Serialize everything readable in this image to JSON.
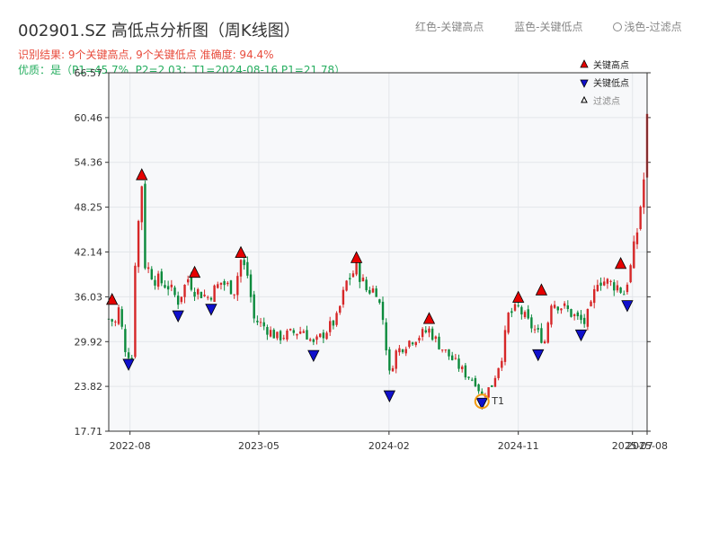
{
  "title": "002901.SZ 高低点分析图（周K线图）",
  "subtitle_result": "识别结果: 9个关键高点, 9个关键低点  准确度: 94.4%",
  "subtitle_quality": "优质：是（P1=45.7%, P2=2.03；T1=2024-08-16 P1=21.78）",
  "top_legend": {
    "red": "红色-关键高点",
    "blue": "蓝色-关键低点",
    "light": "浅色-过滤点"
  },
  "colors": {
    "up": "#d62728",
    "down": "#0b8a3c",
    "high_marker": "#e60000",
    "low_marker": "#1010cc",
    "t1_marker": "#f39c12",
    "plot_bg": "#f7f8fa",
    "grid": "#e3e6ea"
  },
  "chart_data": {
    "type": "candlestick",
    "x_start": "2022-06-17",
    "x_end": "2025-08-01",
    "ylim": [
      17.71,
      66.57
    ],
    "ytick_labels": [
      "17.71",
      "23.82",
      "29.92",
      "36.03",
      "42.14",
      "48.25",
      "54.36",
      "60.46",
      "66.57"
    ],
    "xtick_dates": [
      "2022-08-01",
      "2023-05-01",
      "2024-02-01",
      "2024-11-01",
      "2025-07-01",
      "2025-08-01"
    ],
    "xtick_labels": [
      "2022-08",
      "2023-05",
      "2024-02",
      "2024-11",
      "2025-07",
      "2025-08"
    ],
    "legend": [
      {
        "label": "关键高点",
        "kind": "high"
      },
      {
        "label": "关键低点",
        "kind": "low"
      },
      {
        "label": "过滤点",
        "kind": "filtered"
      }
    ],
    "price_path": [
      [
        "2022-06-17",
        33.0
      ],
      [
        "2022-07-01",
        32.5
      ],
      [
        "2022-07-08",
        34.3
      ],
      [
        "2022-07-22",
        29.0
      ],
      [
        "2022-08-05",
        27.5
      ],
      [
        "2022-08-12",
        41.0
      ],
      [
        "2022-08-26",
        51.5
      ],
      [
        "2022-09-02",
        40.5
      ],
      [
        "2022-09-23",
        38.5
      ],
      [
        "2022-10-21",
        37.5
      ],
      [
        "2022-11-11",
        35.5
      ],
      [
        "2022-12-02",
        38.5
      ],
      [
        "2022-12-16",
        37.0
      ],
      [
        "2023-01-13",
        36.0
      ],
      [
        "2023-02-10",
        38.0
      ],
      [
        "2023-03-10",
        37.0
      ],
      [
        "2023-03-24",
        41.0
      ],
      [
        "2023-04-07",
        39.0
      ],
      [
        "2023-04-21",
        33.0
      ],
      [
        "2023-05-12",
        32.0
      ],
      [
        "2023-06-09",
        30.5
      ],
      [
        "2023-07-07",
        31.0
      ],
      [
        "2023-08-04",
        31.5
      ],
      [
        "2023-08-25",
        29.5
      ],
      [
        "2023-09-15",
        31.0
      ],
      [
        "2023-10-13",
        33.0
      ],
      [
        "2023-11-03",
        38.0
      ],
      [
        "2023-11-24",
        40.0
      ],
      [
        "2023-12-15",
        37.0
      ],
      [
        "2024-01-05",
        37.0
      ],
      [
        "2024-01-19",
        33.0
      ],
      [
        "2024-02-02",
        25.5
      ],
      [
        "2024-02-16",
        28.5
      ],
      [
        "2024-03-15",
        30.0
      ],
      [
        "2024-04-12",
        31.0
      ],
      [
        "2024-04-26",
        31.5
      ],
      [
        "2024-05-17",
        29.5
      ],
      [
        "2024-06-14",
        27.5
      ],
      [
        "2024-07-12",
        25.5
      ],
      [
        "2024-08-02",
        24.5
      ],
      [
        "2024-08-16",
        22.5
      ],
      [
        "2024-09-06",
        24.0
      ],
      [
        "2024-09-27",
        28.0
      ],
      [
        "2024-10-11",
        33.5
      ],
      [
        "2024-11-01",
        34.5
      ],
      [
        "2024-11-22",
        32.5
      ],
      [
        "2024-12-13",
        31.0
      ],
      [
        "2024-12-27",
        30.0
      ],
      [
        "2025-01-10",
        35.5
      ],
      [
        "2025-02-07",
        34.5
      ],
      [
        "2025-03-07",
        33.0
      ],
      [
        "2025-03-21",
        32.5
      ],
      [
        "2025-04-04",
        34.5
      ],
      [
        "2025-04-18",
        38.5
      ],
      [
        "2025-05-09",
        38.0
      ],
      [
        "2025-05-30",
        37.5
      ],
      [
        "2025-06-13",
        36.5
      ],
      [
        "2025-06-27",
        40.0
      ],
      [
        "2025-07-11",
        45.0
      ],
      [
        "2025-07-25",
        52.0
      ],
      [
        "2025-08-01",
        60.0
      ]
    ],
    "key_highs": [
      {
        "date": "2022-06-24",
        "price": 35.6
      },
      {
        "date": "2022-08-26",
        "price": 52.6
      },
      {
        "date": "2022-12-16",
        "price": 39.3
      },
      {
        "date": "2023-03-24",
        "price": 42.0
      },
      {
        "date": "2023-11-24",
        "price": 41.3
      },
      {
        "date": "2024-04-26",
        "price": 33.0
      },
      {
        "date": "2024-11-01",
        "price": 35.9
      },
      {
        "date": "2024-12-20",
        "price": 36.9
      },
      {
        "date": "2025-06-06",
        "price": 40.5
      }
    ],
    "key_lows": [
      {
        "date": "2022-07-29",
        "price": 26.9
      },
      {
        "date": "2022-11-11",
        "price": 33.5
      },
      {
        "date": "2023-01-20",
        "price": 34.4
      },
      {
        "date": "2023-08-25",
        "price": 28.1
      },
      {
        "date": "2024-02-02",
        "price": 22.6
      },
      {
        "date": "2024-08-16",
        "price": 21.6
      },
      {
        "date": "2024-12-13",
        "price": 28.2
      },
      {
        "date": "2025-03-14",
        "price": 30.9
      },
      {
        "date": "2025-06-20",
        "price": 34.9
      }
    ],
    "t1_point": {
      "label": "T1",
      "date": "2024-08-16",
      "price": 21.78
    }
  }
}
